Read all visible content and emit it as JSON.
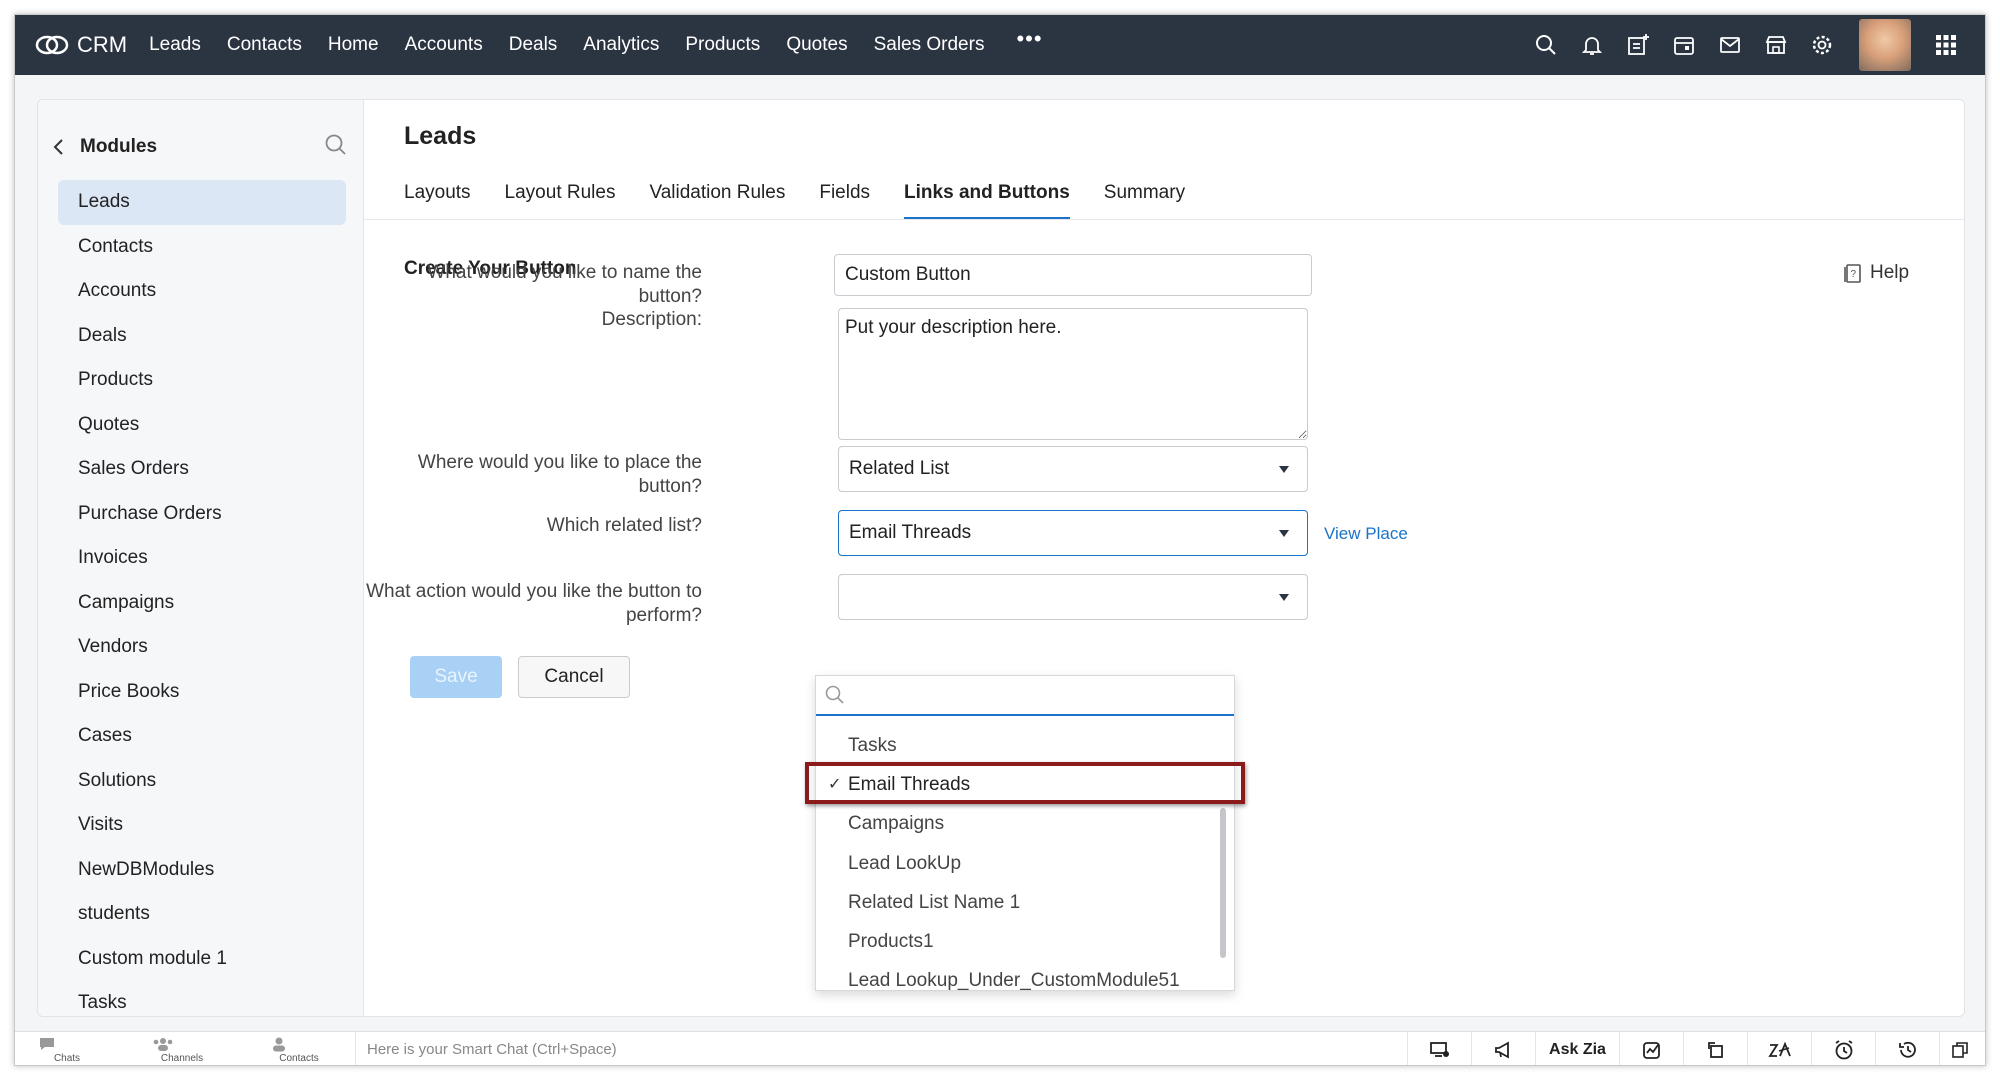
{
  "topnav": {
    "brand": "CRM",
    "items": [
      "Leads",
      "Contacts",
      "Home",
      "Accounts",
      "Deals",
      "Analytics",
      "Products",
      "Quotes",
      "Sales Orders"
    ],
    "more": "•••",
    "icons": [
      "search-icon",
      "bell-icon",
      "add-note-icon",
      "calendar-icon",
      "mail-icon",
      "marketplace-icon",
      "gear-icon",
      "avatar",
      "apps-grid-icon"
    ]
  },
  "sidebar": {
    "title": "Modules",
    "items": [
      {
        "label": "Leads",
        "active": true
      },
      {
        "label": "Contacts"
      },
      {
        "label": "Accounts"
      },
      {
        "label": "Deals"
      },
      {
        "label": "Products"
      },
      {
        "label": "Quotes"
      },
      {
        "label": "Sales Orders"
      },
      {
        "label": "Purchase Orders"
      },
      {
        "label": "Invoices"
      },
      {
        "label": "Campaigns"
      },
      {
        "label": "Vendors"
      },
      {
        "label": "Price Books"
      },
      {
        "label": "Cases"
      },
      {
        "label": "Solutions"
      },
      {
        "label": "Visits"
      },
      {
        "label": "NewDBModules"
      },
      {
        "label": "students"
      },
      {
        "label": "Custom module 1"
      },
      {
        "label": "Tasks"
      }
    ]
  },
  "main": {
    "title": "Leads",
    "tabs": [
      {
        "label": "Layouts"
      },
      {
        "label": "Layout Rules"
      },
      {
        "label": "Validation Rules"
      },
      {
        "label": "Fields"
      },
      {
        "label": "Links and Buttons",
        "active": true
      },
      {
        "label": "Summary"
      }
    ],
    "section_title": "Create Your Button",
    "help": "Help"
  },
  "form": {
    "name_label": "What would you like to name the button?",
    "name_value": "Custom Button",
    "description_label": "Description:",
    "description_value": "Put your description here.",
    "place_label": "Where would you like to place the button?",
    "place_value": "Related List",
    "related_label": "Which related list?",
    "related_value": "Email Threads",
    "view_place": "View Place",
    "action_label": "What action would you like the button to perform?",
    "save": "Save",
    "cancel": "Cancel"
  },
  "dropdown": {
    "search_placeholder": "",
    "items": [
      {
        "label": "Tasks"
      },
      {
        "label": "Email Threads",
        "selected": true
      },
      {
        "label": "Campaigns"
      },
      {
        "label": "Lead LookUp"
      },
      {
        "label": "Related List Name 1"
      },
      {
        "label": "Products1"
      },
      {
        "label": "Lead Lookup_Under_CustomModule51"
      }
    ],
    "highlight_color": "#8b1a1a"
  },
  "bottombar": {
    "left": [
      {
        "label": "Chats",
        "icon": "chat-icon"
      },
      {
        "label": "Channels",
        "icon": "channels-icon"
      },
      {
        "label": "Contacts",
        "icon": "contact-icon"
      }
    ],
    "smartchat_placeholder": "Here is your Smart Chat (Ctrl+Space)",
    "ask_zia": "Ask Zia",
    "right_icons": [
      "screen-share-icon",
      "announcement-icon",
      "ask-zia",
      "signals-icon",
      "rotate-icon",
      "zia-icon",
      "alarm-icon",
      "history-icon",
      "copy-icon"
    ]
  },
  "colors": {
    "topnav_bg": "#2b3441",
    "accent": "#1a73c9",
    "active_sidebar": "#dce7f5",
    "save_disabled": "#a9d0f5"
  }
}
